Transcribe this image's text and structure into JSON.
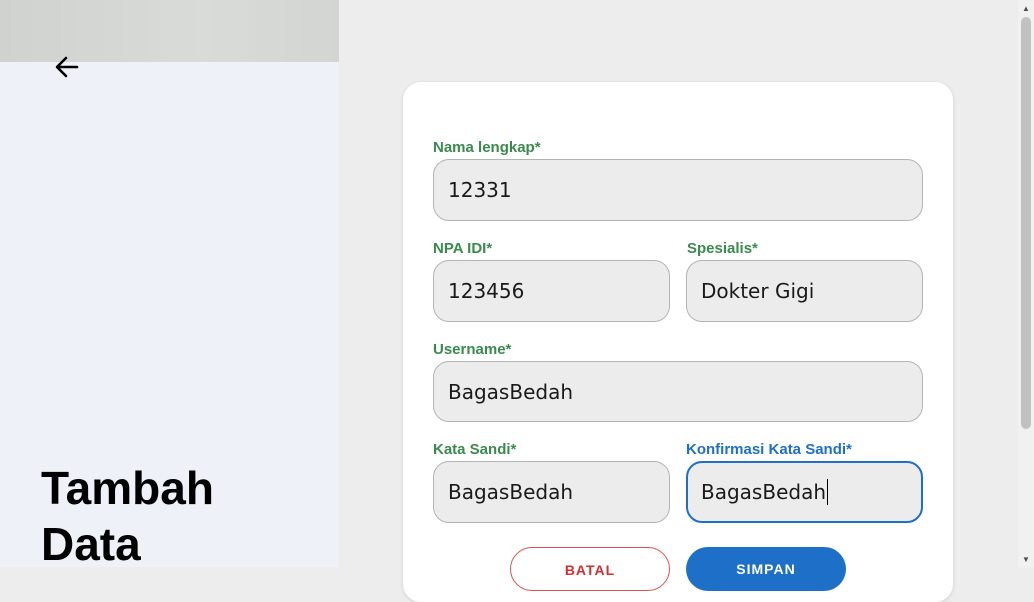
{
  "left": {
    "title_line1": "Tambah",
    "title_line2": "Data",
    "back_icon": "arrow-left-icon"
  },
  "form": {
    "nama_lengkap": {
      "label": "Nama lengkap*",
      "value": "12331"
    },
    "npa_idi": {
      "label": "NPA IDI*",
      "value": "123456"
    },
    "spesialis": {
      "label": "Spesialis*",
      "value": "Dokter Gigi"
    },
    "username": {
      "label": "Username*",
      "value": "BagasBedah"
    },
    "kata_sandi": {
      "label": "Kata Sandi*",
      "value": "BagasBedah"
    },
    "konfirmasi_kata_sandi": {
      "label": "Konfirmasi Kata Sandi*",
      "value": "BagasBedah"
    }
  },
  "buttons": {
    "cancel_label": "BATAL",
    "save_label": "SIMPAN"
  },
  "colors": {
    "label_green": "#3a8a4e",
    "focus_blue": "#1e6fc8",
    "cancel_red": "#d32f2f"
  }
}
